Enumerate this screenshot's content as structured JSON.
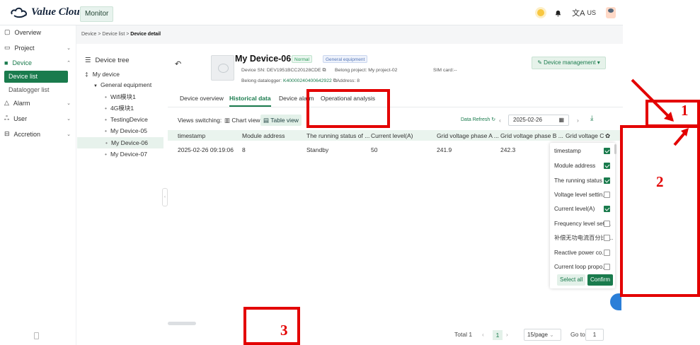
{
  "app": {
    "logo_text": "Value Clouds",
    "monitor_tab": "Monitor",
    "lang": "US"
  },
  "sidebar": {
    "items": [
      {
        "label": "Overview"
      },
      {
        "label": "Project"
      },
      {
        "label": "Device"
      },
      {
        "label": "Alarm"
      },
      {
        "label": "User"
      },
      {
        "label": "Accretion"
      }
    ],
    "sub": [
      "Device list",
      "Datalogger list"
    ]
  },
  "breadcrumb": {
    "a": "Device",
    "b": "Device list",
    "c": "Device detail"
  },
  "tree": {
    "title": "Device tree",
    "root": "My device",
    "group": "General equipment",
    "nodes": [
      "Wifi模块1",
      "4G模块1",
      "TestingDevice",
      "My Device-05",
      "My Device-06",
      "My Device-07"
    ]
  },
  "device": {
    "name": "My Device-06",
    "status": "Normal",
    "type": "General equipment",
    "sn_label": "Device SN:",
    "sn": "DEV1951BCC20128CDE",
    "project_label": "Belong project:",
    "project": "My project-02",
    "sim": "SIM card:--",
    "dl_label": "Belong datalogger:",
    "dl": "K40000240400642922",
    "addr": "Address: 8",
    "mgmt": "Device management"
  },
  "tabs": [
    "Device overview",
    "Historical data",
    "Device alarm",
    "Operational analysis"
  ],
  "toolbar": {
    "views": "Views switching:",
    "chart": "Chart view",
    "table": "Table view",
    "refresh": "Data Refresh",
    "date": "2025-02-26"
  },
  "table": {
    "headers": [
      "timestamp",
      "Module address",
      "The running status of ...",
      "Current level(A)",
      "Grid voltage phase A ...",
      "Grid voltage phase B ...",
      "Grid voltage C"
    ],
    "row": [
      "2025-02-26 09:19:06",
      "8",
      "Standby",
      "50",
      "241.9",
      "242.3"
    ]
  },
  "pager": {
    "total": "Total 1",
    "page": "1",
    "size": "15/page",
    "goto": "Go to",
    "goto_val": "1"
  },
  "columns": {
    "items": [
      {
        "label": "timestamp",
        "on": true
      },
      {
        "label": "Module address",
        "on": true
      },
      {
        "label": "The running status ...",
        "on": true
      },
      {
        "label": "Voltage level settin...",
        "on": false
      },
      {
        "label": "Current level(A)",
        "on": true
      },
      {
        "label": "Frequency level sett...",
        "on": false
      },
      {
        "label": "补偿无功电流百分比(...",
        "on": false
      },
      {
        "label": "Reactive power co...",
        "on": false
      },
      {
        "label": "Current loop propo...",
        "on": false
      }
    ],
    "select_all": "Select all",
    "confirm": "Confirm"
  },
  "annotations": [
    "1",
    "2",
    "3"
  ],
  "colors": {
    "accent": "#1a7b4d",
    "annotation": "#e30000"
  }
}
